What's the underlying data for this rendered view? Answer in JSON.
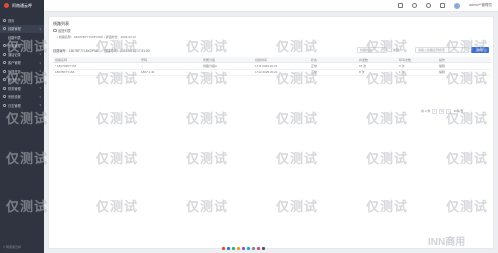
{
  "app": {
    "logo_text": "阿南通云呼",
    "user_name": "admin**管理员"
  },
  "sidebar": {
    "items": [
      {
        "label": "首页",
        "active": false
      },
      {
        "label": "线路管理",
        "active": true
      },
      {
        "label": "线路列表",
        "active": false
      },
      {
        "label": "分机管理",
        "active": false
      },
      {
        "label": "通话记录",
        "active": false
      },
      {
        "label": "客户管理",
        "active": false
      },
      {
        "label": "外呼任务",
        "active": false
      },
      {
        "label": "统计分析",
        "active": false
      },
      {
        "label": "财务管理",
        "active": false
      },
      {
        "label": "系统设置",
        "active": false
      },
      {
        "label": "日志管理",
        "active": false
      }
    ],
    "footer": "© 阿南通云呼"
  },
  "page": {
    "title": "线路列表",
    "back_label": "返回列表",
    "sub_tab": "• 线路名称：1807RB7YYM/PCNW  • 通话时长：2023-03-12"
  },
  "info": {
    "line_no": "线路编号：1807BF7Y18XDP6B",
    "created": "创建时间：2023-03-12 17:31:50"
  },
  "filters": {
    "status": "线路状态",
    "type": "类型",
    "search_placeholder": "请输入线路名称搜索",
    "search_button": "搜索"
  },
  "table": {
    "headers": [
      "线路名称",
      "号码",
      "所属分组",
      "创建时间",
      "状态",
      "并发数",
      "呼叫次数",
      "操作"
    ],
    "rows": [
      [
        "* 1807RB7YYM",
        "--",
        "线路分组A",
        "1711 0025:20:21",
        "正常",
        "15 次",
        "0 次",
        "编辑"
      ],
      [
        "1807BF7Y18A",
        "1807 4 46",
        "--",
        "1712 0025:20:21",
        "正常",
        "8 次",
        "1 次",
        "编辑"
      ]
    ]
  },
  "pager": {
    "total": "共 2 条",
    "page": "1",
    "size": "10条/页"
  },
  "watermark": {
    "text": "仅测试",
    "brand": "INN商用"
  },
  "colors": {
    "sidebar_bg": "#2f3440",
    "accent": "#3a6fd8",
    "logo_mark": "#e04b3a"
  }
}
